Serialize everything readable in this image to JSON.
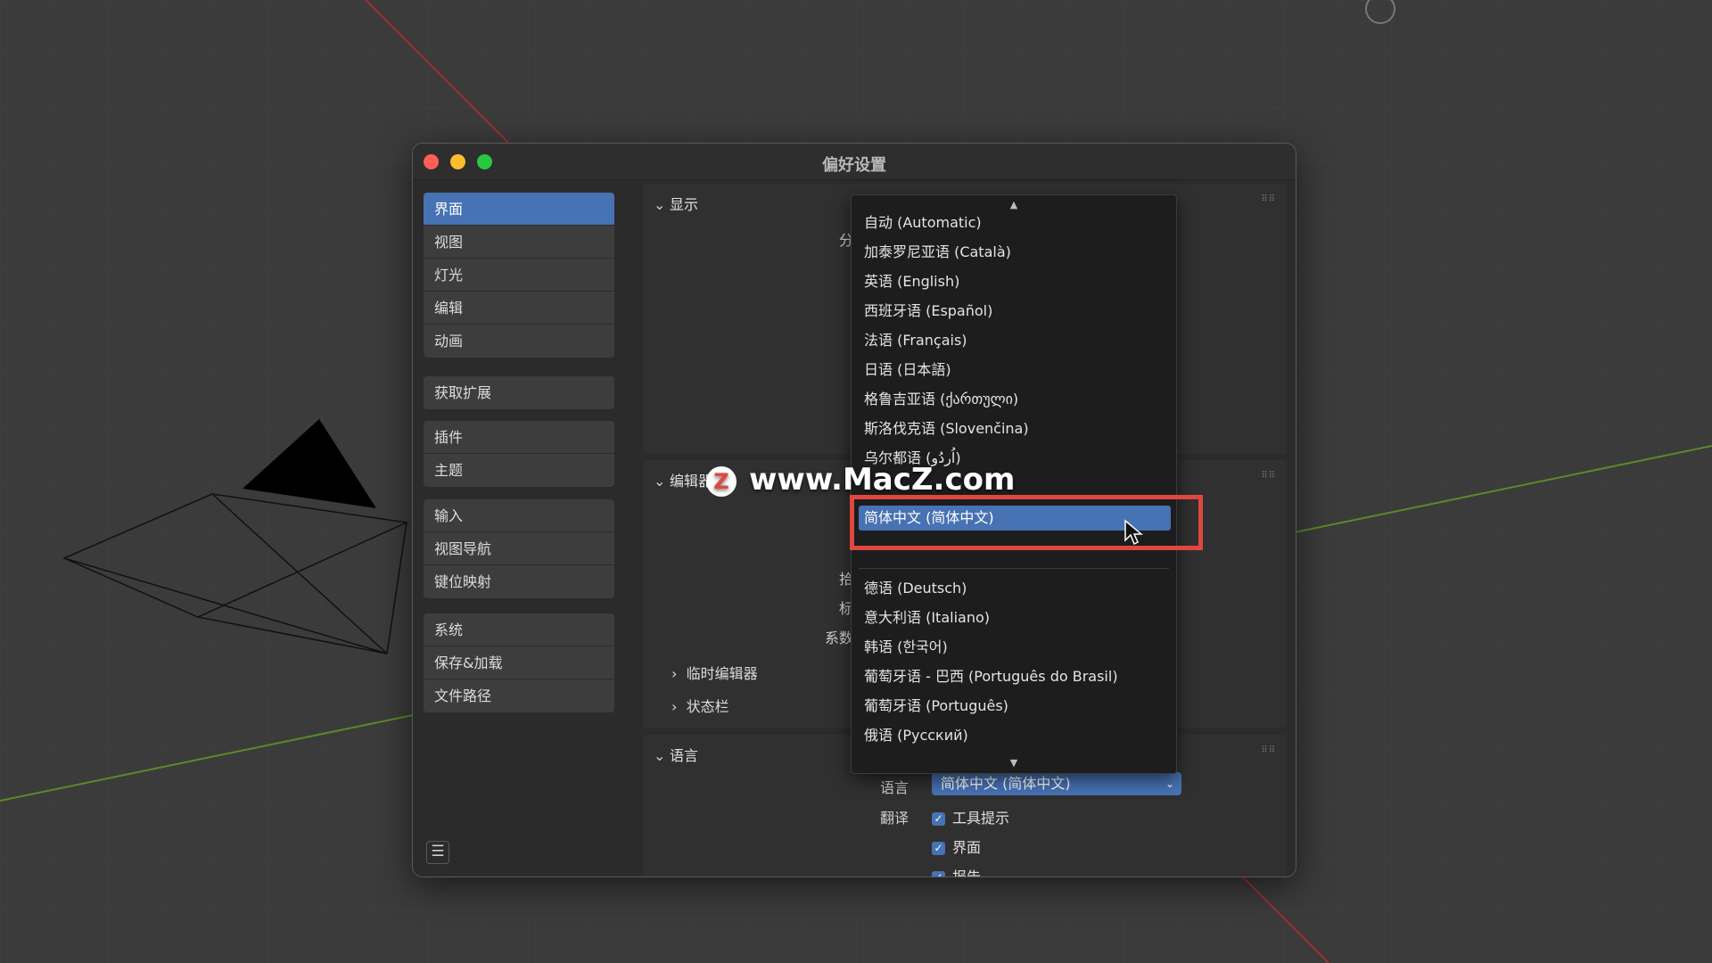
{
  "window": {
    "title": "偏好设置"
  },
  "sidebar": {
    "groups": [
      [
        "界面",
        "视图",
        "灯光",
        "编辑",
        "动画"
      ],
      [
        "获取扩展"
      ],
      [
        "插件",
        "主题"
      ],
      [
        "输入",
        "视图导航",
        "键位映射"
      ],
      [
        "系统",
        "保存&加载",
        "文件路径"
      ]
    ],
    "active": "界面",
    "menu_icon": "hamburger-menu-icon"
  },
  "content": {
    "display_panel": {
      "title": "显示",
      "partial_label": "分"
    },
    "editor_panel": {
      "title": "编辑器",
      "partial_labels": [
        "拾",
        "标",
        "系数"
      ],
      "sub_sections": [
        "临时编辑器",
        "状态栏"
      ]
    },
    "language_panel": {
      "title": "语言",
      "language_label": "语言",
      "language_value": "简体中文 (简体中文)",
      "translate_label": "翻译",
      "checks": [
        "工具提示",
        "界面",
        "报告"
      ]
    }
  },
  "dropdown": {
    "items_top": [
      "自动 (Automatic)",
      "加泰罗尼亚语 (Català)",
      "英语 (English)",
      "西班牙语 (Español)",
      "法语 (Français)",
      "日语 (日本語)",
      "格鲁吉亚语 (ქართული)",
      "斯洛伐克语 (Slovenčina)",
      "乌尔都语 (اُردُو)"
    ],
    "selected": "简体中文 (简体中文)",
    "items_bottom": [
      "德语 (Deutsch)",
      "意大利语 (Italiano)",
      "韩语 (한국어)",
      "葡萄牙语 - 巴西 (Português do Brasil)",
      "葡萄牙语 (Português)",
      "俄语 (Русский)"
    ]
  },
  "watermark": {
    "text": "www.MacZ.com",
    "logo": "Z"
  },
  "colors": {
    "accent": "#4772b3",
    "highlight": "#e0473e"
  }
}
